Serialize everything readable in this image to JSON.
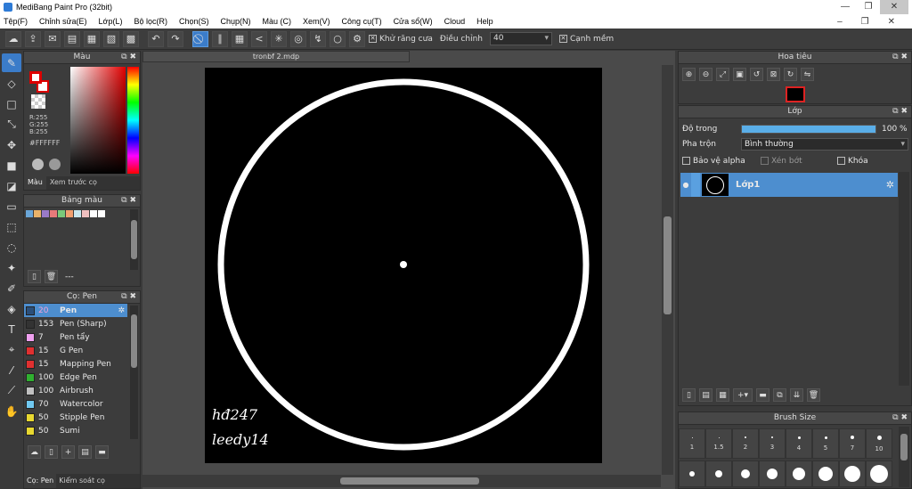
{
  "window": {
    "title": "MediBang Paint Pro (32bit)"
  },
  "menu": [
    "Tệp(F)",
    "Chỉnh sửa(E)",
    "Lớp(L)",
    "Bộ lọc(R)",
    "Chọn(S)",
    "Chụp(N)",
    "Màu (C)",
    "Xem(V)",
    "Công cụ(T)",
    "Cửa sổ(W)",
    "Cloud",
    "Help"
  ],
  "toolbar": {
    "antialias_label": "Khử răng cưa",
    "adjust_label": "Điều chỉnh",
    "adjust_value": "40",
    "smooth_edge_label": "Cạnh mềm"
  },
  "color_panel": {
    "title": "Màu",
    "r": "R:255",
    "g": "G:255",
    "b": "B:255",
    "hex": "#FFFFFF",
    "tab_color": "Màu",
    "tab_brush_preview": "Xem trước cọ"
  },
  "swatch_panel": {
    "title": "Bảng màu",
    "colors": [
      "#6aa6d8",
      "#e8b26a",
      "#9a7ac8",
      "#e87a7a",
      "#7ac87a",
      "#f0a070",
      "#c8e8f0",
      "#f0c0c0",
      "#ffffff",
      "#ffffff"
    ],
    "footer_text": "---"
  },
  "brush_panel": {
    "title": "Cọ: Pen",
    "brushes": [
      {
        "size": "20",
        "name": "Pen",
        "color": "#2b4f7a"
      },
      {
        "size": "153",
        "name": "Pen (Sharp)",
        "color": "#333333"
      },
      {
        "size": "7",
        "name": "Pen tẩy",
        "color": "#f0a0f0"
      },
      {
        "size": "15",
        "name": "G Pen",
        "color": "#e03030"
      },
      {
        "size": "15",
        "name": "Mapping Pen",
        "color": "#e03030"
      },
      {
        "size": "100",
        "name": "Edge Pen",
        "color": "#30b030"
      },
      {
        "size": "100",
        "name": "Airbrush",
        "color": "#c0c0c0"
      },
      {
        "size": "70",
        "name": "Watercolor",
        "color": "#70c8f0"
      },
      {
        "size": "50",
        "name": "Stipple Pen",
        "color": "#e8d830"
      },
      {
        "size": "50",
        "name": "Sumi",
        "color": "#e8d830"
      }
    ],
    "tab_brush": "Cọ: Pen",
    "tab_control": "Kiểm soát cọ"
  },
  "document": {
    "tab_title": "tronbf 2.mdp",
    "signature_line1": "hđ247",
    "signature_line2": "leedy14"
  },
  "navigator": {
    "title": "Hoa tiêu"
  },
  "layer_panel": {
    "title": "Lớp",
    "opacity_label": "Độ trong",
    "opacity_value": "100 %",
    "opacity": 1.0,
    "blend_label": "Pha trộn",
    "blend_value": "Bình thường",
    "protect_alpha": "Bảo vệ alpha",
    "clip": "Xén bớt",
    "lock": "Khóa",
    "layers": [
      {
        "name": "Lớp1"
      }
    ]
  },
  "brush_size_panel": {
    "title": "Brush Size",
    "row1_labels": [
      "1",
      "1.5",
      "2",
      "3",
      "4",
      "5",
      "7",
      "10"
    ]
  }
}
